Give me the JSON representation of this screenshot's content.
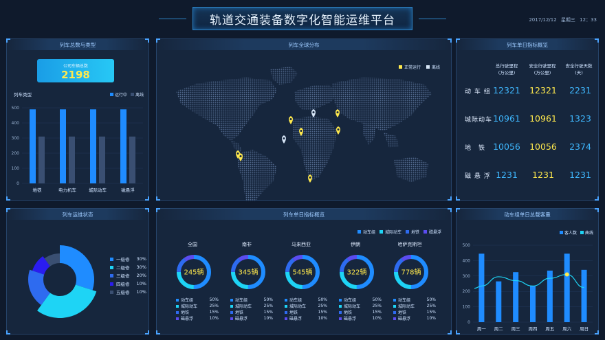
{
  "header": {
    "title": "轨道交通装备数字化智能运维平台",
    "date": "2017/12/12",
    "weekday": "星期三",
    "time": "12：33"
  },
  "panel1": {
    "title": "列车总数与类型",
    "total_label": "公司车辆总数",
    "total_value": "2198",
    "chart_title": "列车类型",
    "legend": [
      "运行中",
      "离线"
    ]
  },
  "panel2": {
    "title": "列车全球分布",
    "legend": [
      "正常运行",
      "离线"
    ]
  },
  "panel3": {
    "title": "列车单日指标概览",
    "columns": [
      {
        "line1": "总行驶里程",
        "line2": "(万公里)"
      },
      {
        "line1": "安全行驶里程",
        "line2": "(万公里)"
      },
      {
        "line1": "安全行驶天数",
        "line2": "(天)"
      }
    ],
    "rows": [
      {
        "label": "动 车 组",
        "v1": "12321",
        "v2": "12321",
        "v3": "2231"
      },
      {
        "label": "城际动车",
        "v1": "10961",
        "v2": "10961",
        "v3": "1323"
      },
      {
        "label": "地　铁",
        "v1": "10056",
        "v2": "10056",
        "v3": "2374"
      },
      {
        "label": "磁 悬 浮",
        "v1": "1231",
        "v2": "1231",
        "v3": "1231"
      }
    ]
  },
  "panel4": {
    "title": "列车运维状态",
    "levels": [
      {
        "name": "一级修",
        "pct": "30%"
      },
      {
        "name": "二级修",
        "pct": "30%"
      },
      {
        "name": "三级修",
        "pct": "20%"
      },
      {
        "name": "四级修",
        "pct": "10%"
      },
      {
        "name": "五级修",
        "pct": "10%"
      }
    ]
  },
  "panel5": {
    "title": "列车单日指标概览",
    "legend": [
      "动车组",
      "城际动车",
      "地铁",
      "磁悬浮"
    ],
    "regions": [
      {
        "name": "全国",
        "count": "245辆",
        "pcts": [
          "50%",
          "25%",
          "15%",
          "10%"
        ]
      },
      {
        "name": "南非",
        "count": "345辆",
        "pcts": [
          "50%",
          "25%",
          "15%",
          "10%"
        ]
      },
      {
        "name": "马来西亚",
        "count": "545辆",
        "pcts": [
          "50%",
          "25%",
          "15%",
          "10%"
        ]
      },
      {
        "name": "伊朗",
        "count": "322辆",
        "pcts": [
          "50%",
          "25%",
          "15%",
          "10%"
        ]
      },
      {
        "name": "哈萨克斯坦",
        "count": "778辆",
        "pcts": [
          "50%",
          "25%",
          "15%",
          "10%"
        ]
      }
    ]
  },
  "panel6": {
    "title": "动车组单日总载客量"
  },
  "colors": {
    "blue": "#1f8cff",
    "cyan": "#1ed4f5",
    "yellow": "#ffe94d",
    "gray": "#3a4f72"
  },
  "chart_data": [
    {
      "type": "bar",
      "categories": [
        "地铁",
        "电力机车",
        "城际动车",
        "磁悬浮"
      ],
      "series": [
        {
          "name": "运行中",
          "values": [
            490,
            490,
            490,
            490
          ]
        },
        {
          "name": "离线",
          "values": [
            310,
            310,
            310,
            310
          ]
        }
      ],
      "ylim": [
        0,
        500
      ],
      "yticks": [
        0,
        100,
        200,
        300,
        400,
        500
      ],
      "legend": "top-right"
    },
    {
      "type": "pie",
      "categories": [
        "一级修",
        "二级修",
        "三级修",
        "四级修",
        "五级修"
      ],
      "values": [
        30,
        30,
        20,
        10,
        10
      ],
      "legend": "right"
    },
    {
      "type": "bar",
      "categories": [
        "周一",
        "周二",
        "周三",
        "周四",
        "周五",
        "周六",
        "周日"
      ],
      "series": [
        {
          "name": "客人数",
          "values": [
            445,
            265,
            325,
            235,
            335,
            445,
            340
          ]
        },
        {
          "name": "曲线",
          "values": [
            235,
            295,
            270,
            235,
            285,
            310,
            225
          ]
        }
      ],
      "ylim": [
        0,
        500
      ],
      "yticks": [
        0,
        100,
        200,
        300,
        400,
        500
      ],
      "legend": "top-right"
    }
  ]
}
